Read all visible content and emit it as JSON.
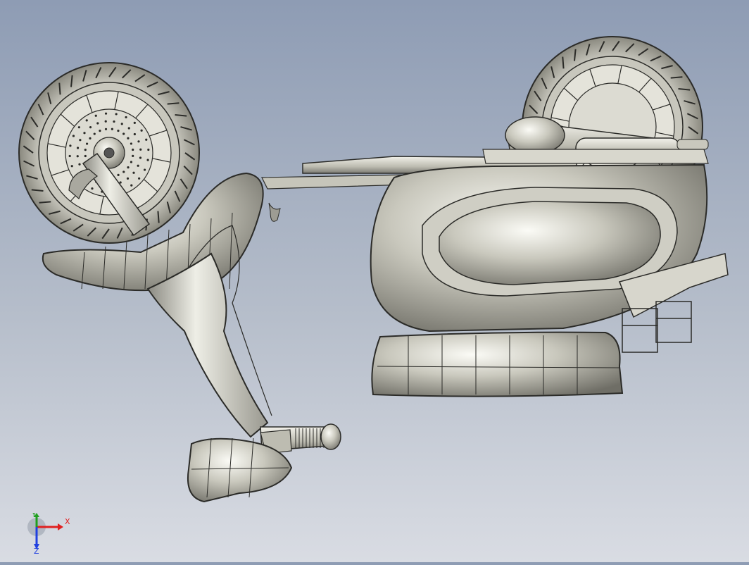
{
  "viewport": {
    "model": "motorcycle-assembly",
    "display_style": "shaded-with-edges"
  },
  "triad": {
    "x_label": "X",
    "y_label": "Y",
    "z_label": "Z",
    "x_color": "#e02020",
    "y_color": "#20a020",
    "z_color": "#2040e0"
  }
}
